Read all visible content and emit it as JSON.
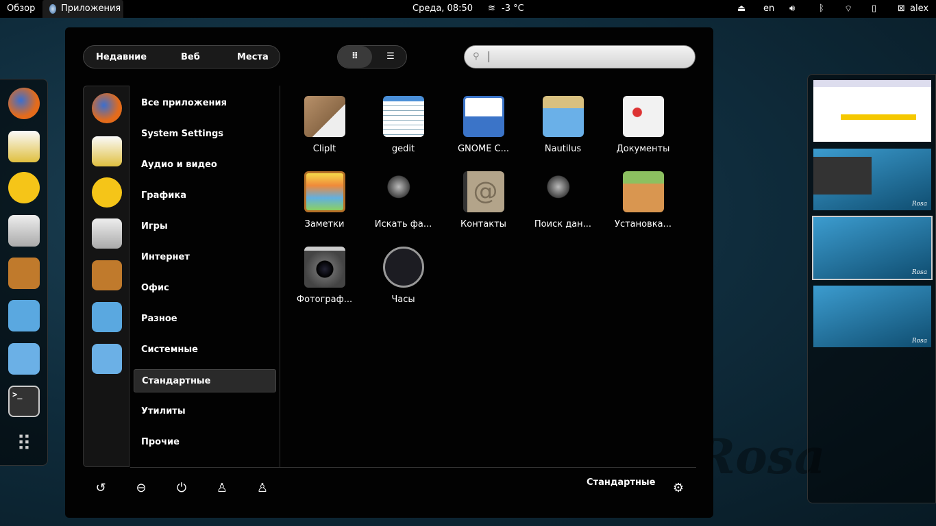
{
  "topbar": {
    "overview": "Обзор",
    "apps": "Приложения",
    "clock": "Среда, 08:50",
    "weather": "-3 °C",
    "lang": "en",
    "user": "alex"
  },
  "watermark": "Rosa",
  "tabs": [
    "Недавние",
    "Веб",
    "Места"
  ],
  "search": {
    "value": ""
  },
  "categories": [
    "Все приложения",
    "System Settings",
    "Аудио и видео",
    "Графика",
    "Игры",
    "Интернет",
    "Офис",
    "Разное",
    "Системные",
    "Стандартные",
    "Утилиты",
    "Прочие"
  ],
  "selected_category": "Стандартные",
  "apps": [
    "ClipIt",
    "gedit",
    "GNOME C...",
    "Nautilus",
    "Документы",
    "Заметки",
    "Искать фа...",
    "Контакты",
    "Поиск дан...",
    "Установка...",
    "Фотограф...",
    "Часы"
  ],
  "footer": {
    "category": "Стандартные"
  },
  "thumb_label": "Rosa"
}
